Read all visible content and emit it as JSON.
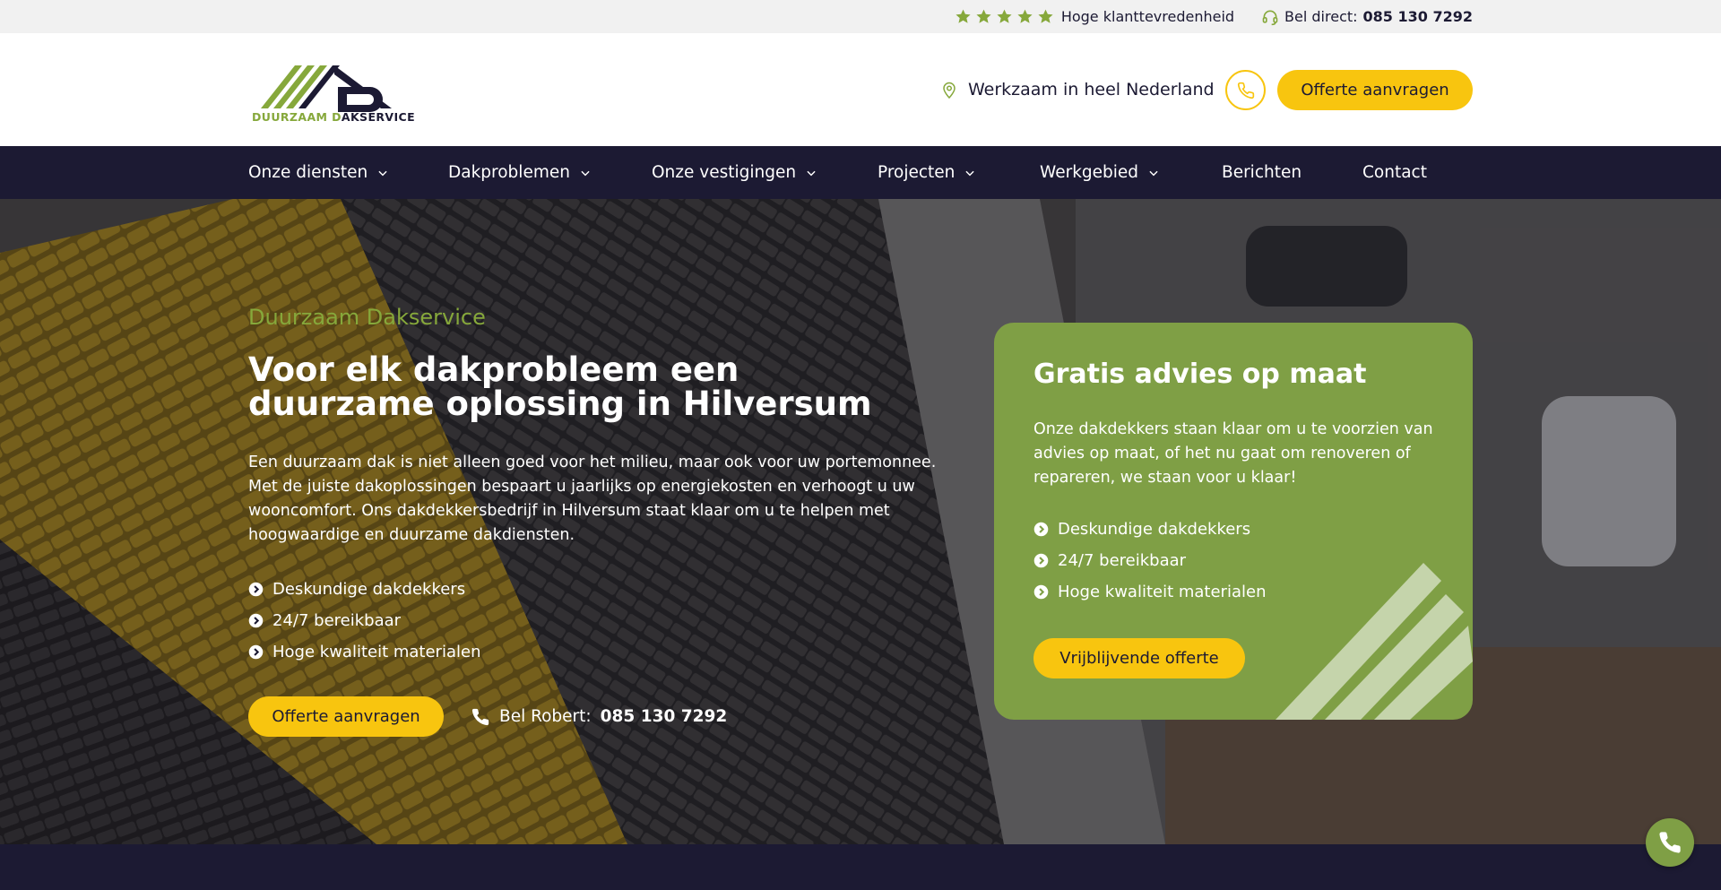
{
  "topbar": {
    "rating_text": "Hoge klanttevredenheid",
    "stars": 5,
    "call_label": "Bel direct:",
    "call_number": "085 130 7292"
  },
  "header": {
    "logo_text_green": "DUURZAAM D",
    "logo_text_dark": "AKSERVICE",
    "region": "Werkzaam in heel Nederland",
    "cta": "Offerte aanvragen"
  },
  "nav": {
    "items": [
      {
        "label": "Onze diensten"
      },
      {
        "label": "Dakproblemen"
      },
      {
        "label": "Onze vestigingen"
      },
      {
        "label": "Projecten"
      },
      {
        "label": "Werkgebied"
      },
      {
        "label": "Berichten"
      },
      {
        "label": "Contact"
      }
    ]
  },
  "hero": {
    "kicker": "Duurzaam Dakservice",
    "title": "Voor elk dakprobleem een duurzame oplossing in Hilversum",
    "text": "Een duurzaam dak is niet alleen goed voor het milieu, maar ook voor uw portemonnee. Met de juiste dakoplossingen bespaart u jaarlijks op energiekosten en verhoogt u uw wooncomfort. Ons dakdekkersbedrijf in Hilversum staat klaar om u te helpen met hoogwaardige en duurzame dakdiensten.",
    "checks": [
      "Deskundige dakdekkers",
      "24/7 bereikbaar",
      "Hoge kwaliteit materialen"
    ],
    "cta": "Offerte aanvragen",
    "bel_label": "Bel Robert:",
    "bel_number": "085 130 7292"
  },
  "card": {
    "title": "Gratis advies op maat",
    "text": "Onze dakdekkers staan klaar om u te voorzien van advies op maat, of het nu gaat om renoveren of repareren, we staan voor u klaar!",
    "checks": [
      "Deskundige dakdekkers",
      "24/7 bereikbaar",
      "Hoge kwaliteit materialen"
    ],
    "cta": "Vrijblijvende offerte"
  },
  "colors": {
    "navy": "#1c1a33",
    "green": "#7f9f45",
    "yellow": "#f8c50f"
  }
}
